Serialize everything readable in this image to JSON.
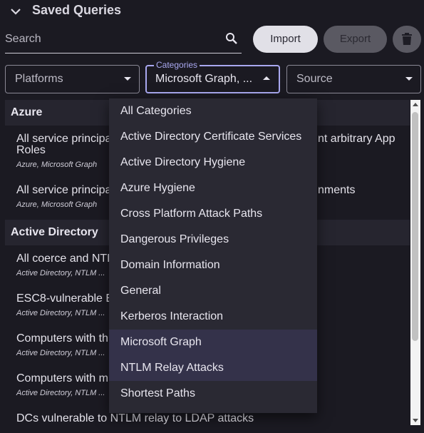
{
  "header": {
    "title": "Saved Queries"
  },
  "search": {
    "placeholder": "Search",
    "value": ""
  },
  "toolbar": {
    "import_label": "Import",
    "export_label": "Export"
  },
  "filters": {
    "platforms": {
      "value": "Platforms"
    },
    "categories": {
      "label": "Categories",
      "value": "Microsoft Graph, ..."
    },
    "source": {
      "value": "Source"
    }
  },
  "list": {
    "groups": [
      {
        "title": "Azure",
        "items": [
          {
            "name_left": "All service principa",
            "name_right": "nt arbitrary App",
            "name_line2": "Roles",
            "tags": "Azure, Microsoft Graph"
          },
          {
            "name_left": "All service principa",
            "name_right": "nments",
            "tags": "Azure, Microsoft Graph"
          }
        ]
      },
      {
        "title": "Active Directory",
        "items": [
          {
            "name_left": "All coerce and NTL",
            "tags": "Active Directory, NTLM ..."
          },
          {
            "name_left": "ESC8-vulnerable E",
            "tags": "Active Directory, NTLM ..."
          },
          {
            "name_left": "Computers with th",
            "tags": "Active Directory, NTLM ..."
          },
          {
            "name_left": "Computers with m",
            "tags": "Active Directory, NTLM ..."
          },
          {
            "name_left": "DCs vulnerable to NTLM relay to LDAP attacks",
            "tags": ""
          }
        ]
      }
    ]
  },
  "menu": {
    "options": [
      {
        "label": "All Categories",
        "selected": false
      },
      {
        "label": "Active Directory Certificate Services",
        "selected": false
      },
      {
        "label": "Active Directory Hygiene",
        "selected": false
      },
      {
        "label": "Azure Hygiene",
        "selected": false
      },
      {
        "label": "Cross Platform Attack Paths",
        "selected": false
      },
      {
        "label": "Dangerous Privileges",
        "selected": false
      },
      {
        "label": "Domain Information",
        "selected": false
      },
      {
        "label": "General",
        "selected": false
      },
      {
        "label": "Kerberos Interaction",
        "selected": false
      },
      {
        "label": "Microsoft Graph",
        "selected": true
      },
      {
        "label": "NTLM Relay Attacks",
        "selected": true
      },
      {
        "label": "Shortest Paths",
        "selected": false
      }
    ]
  },
  "colors": {
    "background": "#1b1a22",
    "accent": "#a9a8f0",
    "menu_bg": "#2a2933",
    "selected_bg": "#34324a"
  },
  "icons": [
    "chevron-down-icon",
    "search-icon",
    "trash-icon",
    "dropdown-arrow-icon"
  ]
}
